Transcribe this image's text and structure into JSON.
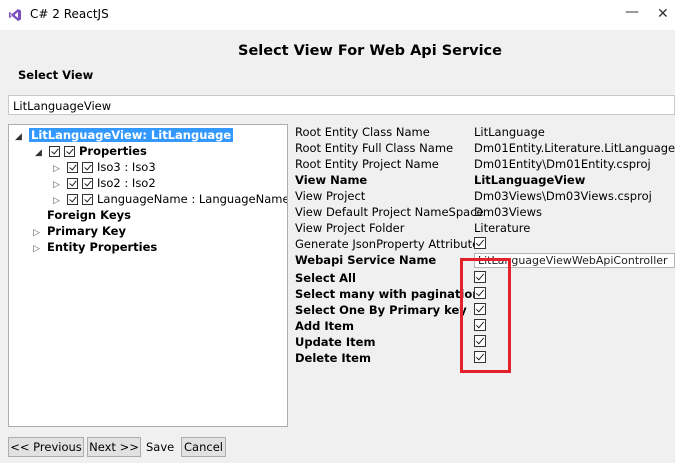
{
  "window": {
    "title": "C# 2 ReactJS",
    "minimize": "—",
    "close": "✕"
  },
  "dialog": {
    "title": "Select View For Web Api Service"
  },
  "select_view": {
    "label": "Select View",
    "value": "LitLanguageView"
  },
  "tree": {
    "root": "LitLanguageView: LitLanguage",
    "properties": "Properties",
    "items": [
      "Iso3 : Iso3",
      "Iso2 : Iso2",
      "LanguageName : LanguageName"
    ],
    "foreign_keys": "Foreign Keys",
    "primary_key": "Primary Key",
    "entity_properties": "Entity Properties"
  },
  "properties": {
    "root_entity_class_name": {
      "label": "Root Entity Class Name",
      "value": "LitLanguage"
    },
    "root_entity_full_class_name": {
      "label": "Root Entity Full Class Name",
      "value": "Dm01Entity.Literature.LitLanguage"
    },
    "root_entity_project_name": {
      "label": "Root Entity Project Name",
      "value": "Dm01Entity\\Dm01Entity.csproj"
    },
    "view_name": {
      "label": "View Name",
      "value": "LitLanguageView"
    },
    "view_project": {
      "label": "View Project",
      "value": "Dm03Views\\Dm03Views.csproj"
    },
    "view_default_namespace": {
      "label": "View Default Project NameSpace",
      "value": "Dm03Views"
    },
    "view_project_folder": {
      "label": "View Project Folder",
      "value": "Literature"
    },
    "generate_json_property": {
      "label": "Generate JsonProperty Attribute",
      "checked": true
    },
    "webapi_service_name": {
      "label": "Webapi Service Name",
      "value": "LitLanguageViewWebApiController"
    }
  },
  "options": {
    "select_all": {
      "label": "Select All",
      "checked": true
    },
    "select_many": {
      "label": "Select many with pagination",
      "checked": true
    },
    "select_one": {
      "label": "Select One By Primary key",
      "checked": true
    },
    "add_item": {
      "label": "Add Item",
      "checked": true
    },
    "update_item": {
      "label": "Update Item",
      "checked": true
    },
    "delete_item": {
      "label": "Delete Item",
      "checked": true
    }
  },
  "footer": {
    "previous": "<< Previous",
    "next": "Next >>",
    "save": "Save",
    "cancel": "Cancel"
  },
  "colors": {
    "selection": "#3399ff",
    "highlight": "#e3212b"
  }
}
